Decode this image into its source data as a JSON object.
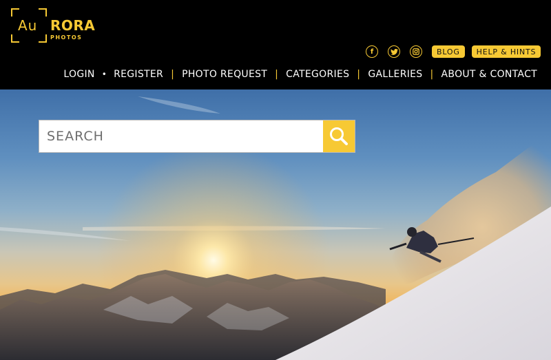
{
  "logo": {
    "au": "Au",
    "rora": "RORA",
    "photos": "PHOTOS"
  },
  "social": {
    "icons": [
      "facebook-icon",
      "twitter-icon",
      "instagram-icon"
    ],
    "blog_label": "BLOG",
    "help_label": "HELP & HINTS"
  },
  "nav": {
    "login": "LOGIN",
    "dot": "•",
    "register": "REGISTER",
    "separator": "|",
    "photo_request": "PHOTO REQUEST",
    "categories": "CATEGORIES",
    "galleries": "GALLERIES",
    "about_contact": "ABOUT & CONTACT"
  },
  "search": {
    "placeholder": "SEARCH"
  },
  "colors": {
    "accent": "#f7c934",
    "header_bg": "#000000"
  }
}
